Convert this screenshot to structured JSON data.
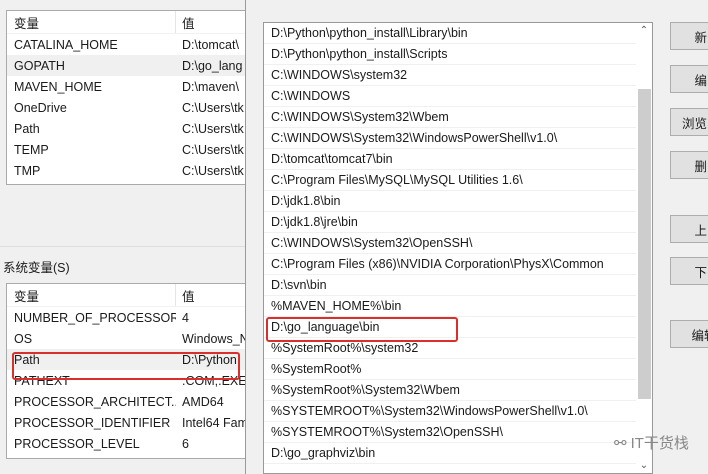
{
  "user_vars": {
    "headers": [
      "变量",
      "值"
    ],
    "rows": [
      [
        "CATALINA_HOME",
        "D:\\tomcat\\"
      ],
      [
        "GOPATH",
        "D:\\go_lang"
      ],
      [
        "MAVEN_HOME",
        "D:\\maven\\"
      ],
      [
        "OneDrive",
        "C:\\Users\\tk"
      ],
      [
        "Path",
        "C:\\Users\\tk"
      ],
      [
        "TEMP",
        "C:\\Users\\tk"
      ],
      [
        "TMP",
        "C:\\Users\\tk"
      ]
    ]
  },
  "system_section_label": "系统变量(S)",
  "system_vars": {
    "headers": [
      "变量",
      "值"
    ],
    "rows": [
      [
        "NUMBER_OF_PROCESSORS",
        "4"
      ],
      [
        "OS",
        "Windows_N"
      ],
      [
        "Path",
        "D:\\Python"
      ],
      [
        "PATHEXT",
        ".COM;.EXE"
      ],
      [
        "PROCESSOR_ARCHITECT...",
        "AMD64"
      ],
      [
        "PROCESSOR_IDENTIFIER",
        "Intel64 Fam"
      ],
      [
        "PROCESSOR_LEVEL",
        "6"
      ]
    ]
  },
  "path_entries": [
    "D:\\Python\\python_install\\Library\\bin",
    "D:\\Python\\python_install\\Scripts",
    "C:\\WINDOWS\\system32",
    "C:\\WINDOWS",
    "C:\\WINDOWS\\System32\\Wbem",
    "C:\\WINDOWS\\System32\\WindowsPowerShell\\v1.0\\",
    "D:\\tomcat\\tomcat7\\bin",
    "C:\\Program Files\\MySQL\\MySQL Utilities 1.6\\",
    "D:\\jdk1.8\\bin",
    "D:\\jdk1.8\\jre\\bin",
    "C:\\WINDOWS\\System32\\OpenSSH\\",
    "C:\\Program Files (x86)\\NVIDIA Corporation\\PhysX\\Common",
    "D:\\svn\\bin",
    "%MAVEN_HOME%\\bin",
    "D:\\go_language\\bin",
    "%SystemRoot%\\system32",
    "%SystemRoot%",
    "%SystemRoot%\\System32\\Wbem",
    "%SYSTEMROOT%\\System32\\WindowsPowerShell\\v1.0\\",
    "%SYSTEMROOT%\\System32\\OpenSSH\\",
    "D:\\go_graphviz\\bin"
  ],
  "buttons": {
    "new": "新",
    "edit": "编",
    "browse": "浏览",
    "delete": "删",
    "move_up": "上",
    "move_down": "下",
    "edit_text": "编辑文"
  },
  "watermark": "IT干货栈",
  "colors": {
    "highlight": "#d9302c"
  }
}
